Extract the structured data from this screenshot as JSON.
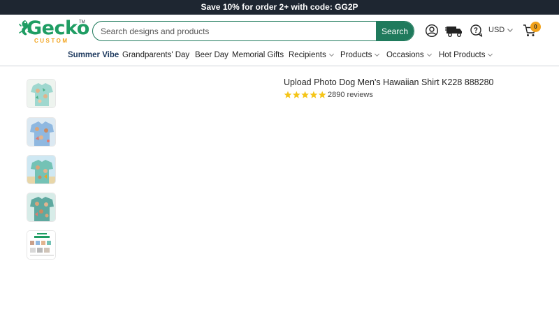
{
  "promo": {
    "text": "Save 10% for order 2+ with code: GG2P"
  },
  "brand": {
    "name": "Gecko",
    "sub": "CUSTOM",
    "tm": "TM"
  },
  "search": {
    "placeholder": "Search designs and products",
    "button_label": "Search"
  },
  "header": {
    "currency": "USD",
    "cart_count": "0"
  },
  "nav": {
    "items": [
      {
        "label": "Summer Vibe",
        "has_dropdown": false,
        "active": true
      },
      {
        "label": "Grandparents' Day",
        "has_dropdown": false
      },
      {
        "label": "Beer Day",
        "has_dropdown": false
      },
      {
        "label": "Memorial Gifts",
        "has_dropdown": false
      },
      {
        "label": "Recipients",
        "has_dropdown": true
      },
      {
        "label": "Products",
        "has_dropdown": true
      },
      {
        "label": "Occasions",
        "has_dropdown": true
      },
      {
        "label": "Hot Products",
        "has_dropdown": true
      }
    ]
  },
  "product": {
    "title": "Upload Photo Dog Men's Hawaiian Shirt K228 888280",
    "rating_stars": 5,
    "reviews_text": "2890 reviews",
    "thumbnail_count": 5
  },
  "colors": {
    "brand_green": "#1f9d63",
    "accent_teal": "#1f7a5c",
    "promo_bg": "#1e2631",
    "badge_orange": "#f2a21a",
    "star_yellow": "#f5c518"
  },
  "icons": [
    "gecko-logo-icon",
    "account-icon",
    "shipping-truck-icon",
    "support-chat-icon",
    "chevron-down-icon",
    "cart-icon",
    "star-icon"
  ]
}
